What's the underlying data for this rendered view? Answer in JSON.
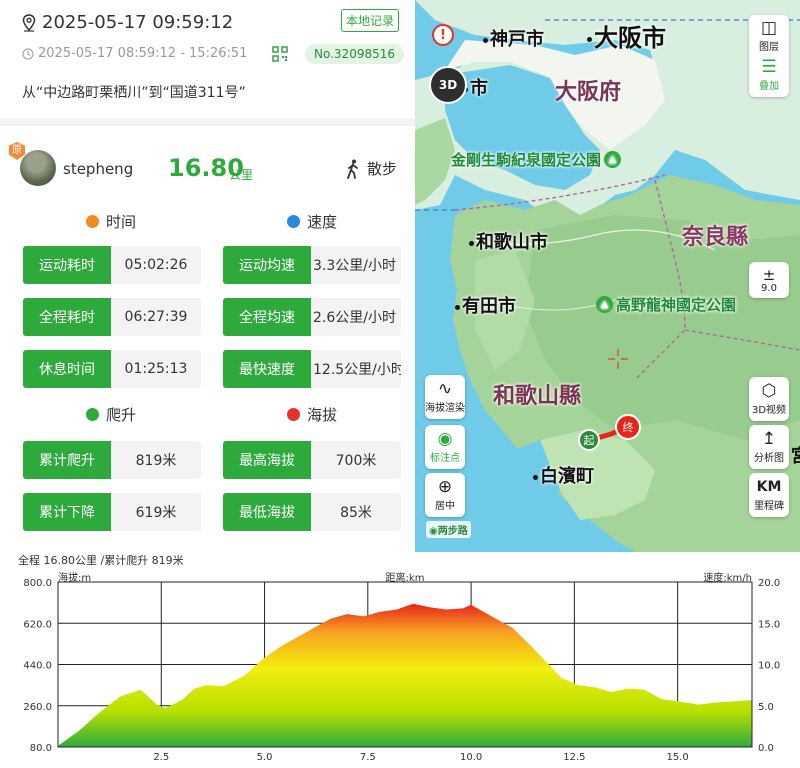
{
  "header": {
    "datetime": "2025-05-17 09:59:12",
    "local_tag": "本地记录",
    "time_range": "2025-05-17 08:59:12 - 15:26:51",
    "record_no": "No.32098516",
    "route": "从“中边路町栗栖川”到“国道311号”"
  },
  "user": {
    "badge": "原",
    "name": "stepheng",
    "distance": "16.80",
    "distance_unit": "公里",
    "activity": "散步"
  },
  "sections": {
    "time": "时间",
    "speed": "速度",
    "climb": "爬升",
    "altitude": "海拔"
  },
  "stats": {
    "move_time": {
      "label": "运动耗时",
      "value": "05:02:26"
    },
    "total_time": {
      "label": "全程耗时",
      "value": "06:27:39"
    },
    "rest_time": {
      "label": "休息时间",
      "value": "01:25:13"
    },
    "avg_move_speed": {
      "label": "运动均速",
      "value": "3.3公里/小时"
    },
    "avg_total_speed": {
      "label": "全程均速",
      "value": "2.6公里/小时"
    },
    "max_speed": {
      "label": "最快速度",
      "value": "12.5公里/小时"
    },
    "total_ascent": {
      "label": "累计爬升",
      "value": "819米"
    },
    "total_descent": {
      "label": "累计下降",
      "value": "619米"
    },
    "max_alt": {
      "label": "最高海拔",
      "value": "700米"
    },
    "min_alt": {
      "label": "最低海拔",
      "value": "85米"
    }
  },
  "map": {
    "cities": [
      "神戸市",
      "大阪市",
      "市",
      "和歌山市",
      "有田市",
      "白濱町"
    ],
    "prefectures": [
      "大阪府",
      "奈良縣",
      "和歌山縣"
    ],
    "parks": [
      "金剛生駒紀泉國定公園",
      "高野龍神國定公園"
    ],
    "right_edge_glyph": "宮",
    "layers_label": "图层",
    "overlay_label": "叠加",
    "btn_3d": "3D",
    "zoom_value": "9.0",
    "elev_render_label": "海拔渲染",
    "mark_label": "标注点",
    "center_label": "居中",
    "view3d_label": "3D视频",
    "analysis_label": "分析图",
    "milestone_glyph": "KM",
    "milestone_label": "里程碑",
    "start_label": "起",
    "end_label": "终",
    "brand": "两步路",
    "icons": [
      "layers-icon",
      "overlay-icon",
      "warning-icon",
      "zoom-icon",
      "crosshair-icon"
    ]
  },
  "chart_data": {
    "type": "area",
    "summary": "全程 16.80公里 /累计爬升 819米",
    "ylabel": "海拔:m",
    "xlabel": "距离:km",
    "y2label": "速度:km/h",
    "xlim": [
      0,
      16.8
    ],
    "ylim": [
      80,
      800
    ],
    "y2lim": [
      0,
      20
    ],
    "x_ticks": [
      "2.5",
      "5.0",
      "7.5",
      "10.0",
      "12.5",
      "15.0"
    ],
    "y_ticks": [
      "800.0",
      "620.0",
      "440.0",
      "260.0",
      "80.0"
    ],
    "y2_ticks": [
      "20.0",
      "15.0",
      "10.0",
      "5.0",
      "0.0"
    ],
    "grid": true,
    "colors": [
      "#2eaa3d",
      "#b7e000",
      "#f2ee10",
      "#f7a321",
      "#e8241c"
    ],
    "series": [
      {
        "x": [
          0,
          0.5,
          1.0,
          1.5,
          2.0,
          2.4,
          2.6,
          3.0,
          3.3,
          3.6,
          4.0,
          4.5,
          5.0,
          5.4,
          5.8,
          6.2,
          6.6,
          7.0,
          7.4,
          7.8,
          8.2,
          8.6,
          9.0,
          9.4,
          9.8,
          10.0,
          10.2,
          10.6,
          11.0,
          11.4,
          11.8,
          12.2,
          12.6,
          13.0,
          13.4,
          13.8,
          14.2,
          14.6,
          15.0,
          15.5,
          16.0,
          16.4,
          16.8
        ],
        "values": [
          85,
          150,
          230,
          300,
          330,
          265,
          250,
          285,
          335,
          350,
          345,
          390,
          470,
          520,
          560,
          600,
          640,
          660,
          650,
          670,
          680,
          705,
          690,
          680,
          685,
          700,
          680,
          640,
          600,
          530,
          455,
          380,
          350,
          340,
          320,
          335,
          330,
          290,
          280,
          265,
          275,
          280,
          285
        ]
      }
    ]
  }
}
